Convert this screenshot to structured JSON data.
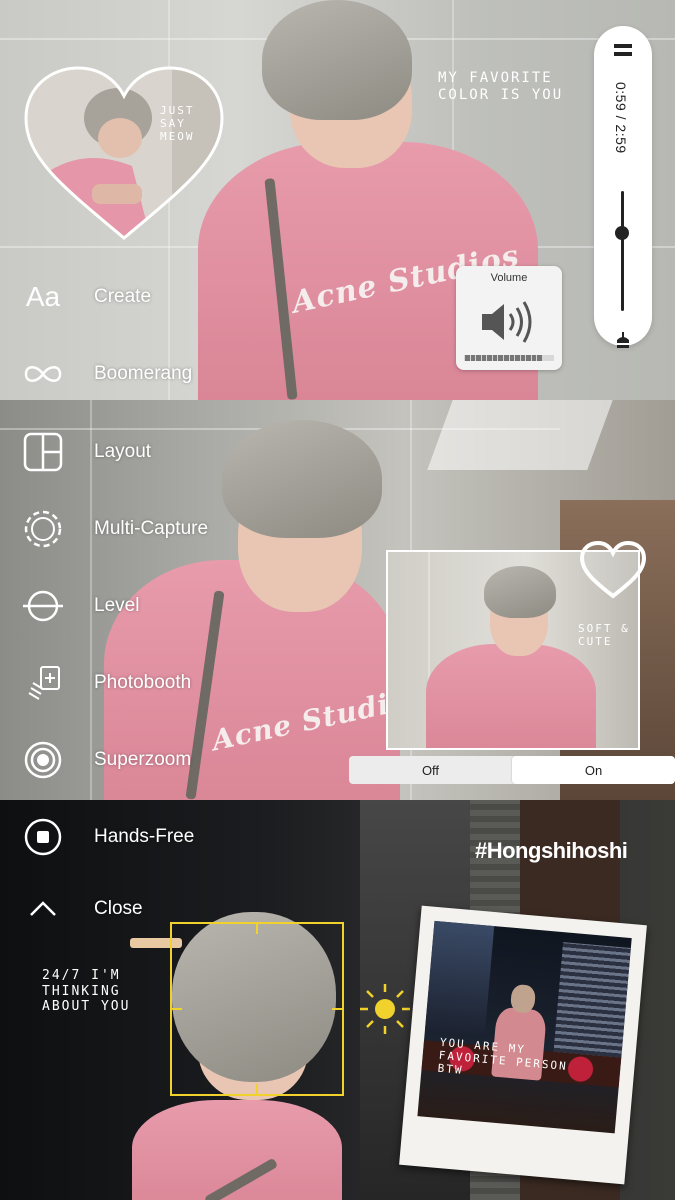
{
  "panels": {
    "top": {
      "heart_caption": "JUST SAY MEOW",
      "favorite_caption": "MY FAVORITE COLOR IS YOU",
      "shirt_logo": "Acne Studios"
    },
    "middle": {
      "inset_caption": "SOFT & CUTE",
      "shirt_logo": "Acne Studios"
    },
    "bottom": {
      "hashtag": "#Hongshihoshi",
      "thinking_caption": "24/7 I'M THINKING ABOUT YOU",
      "polaroid_caption": "YOU ARE MY FAVORITE PERSON BTW"
    }
  },
  "camera_modes": [
    {
      "label": "Create",
      "icon": "aa-text-icon"
    },
    {
      "label": "Boomerang",
      "icon": "infinity-icon"
    },
    {
      "label": "Layout",
      "icon": "layout-grid-icon"
    },
    {
      "label": "Multi-Capture",
      "icon": "dashed-circle-icon"
    },
    {
      "label": "Level",
      "icon": "level-icon"
    },
    {
      "label": "Photobooth",
      "icon": "photobooth-icon"
    },
    {
      "label": "Superzoom",
      "icon": "superzoom-icon"
    },
    {
      "label": "Hands-Free",
      "icon": "record-stop-icon"
    },
    {
      "label": "Close",
      "icon": "chevron-up-icon"
    }
  ],
  "create_icon_text": "Aa",
  "music_player": {
    "time": "0:59 / 2:59",
    "progress": 0.33,
    "slider_level": 0.35
  },
  "volume_hud": {
    "title": "Volume",
    "level": 0.9,
    "segments": 16
  },
  "toggle": {
    "off_label": "Off",
    "on_label": "On",
    "selected": "On"
  },
  "colors": {
    "focus_box": "#f1d12c",
    "shirt_pink": "#e79bab",
    "sun": "#f1d12c"
  }
}
